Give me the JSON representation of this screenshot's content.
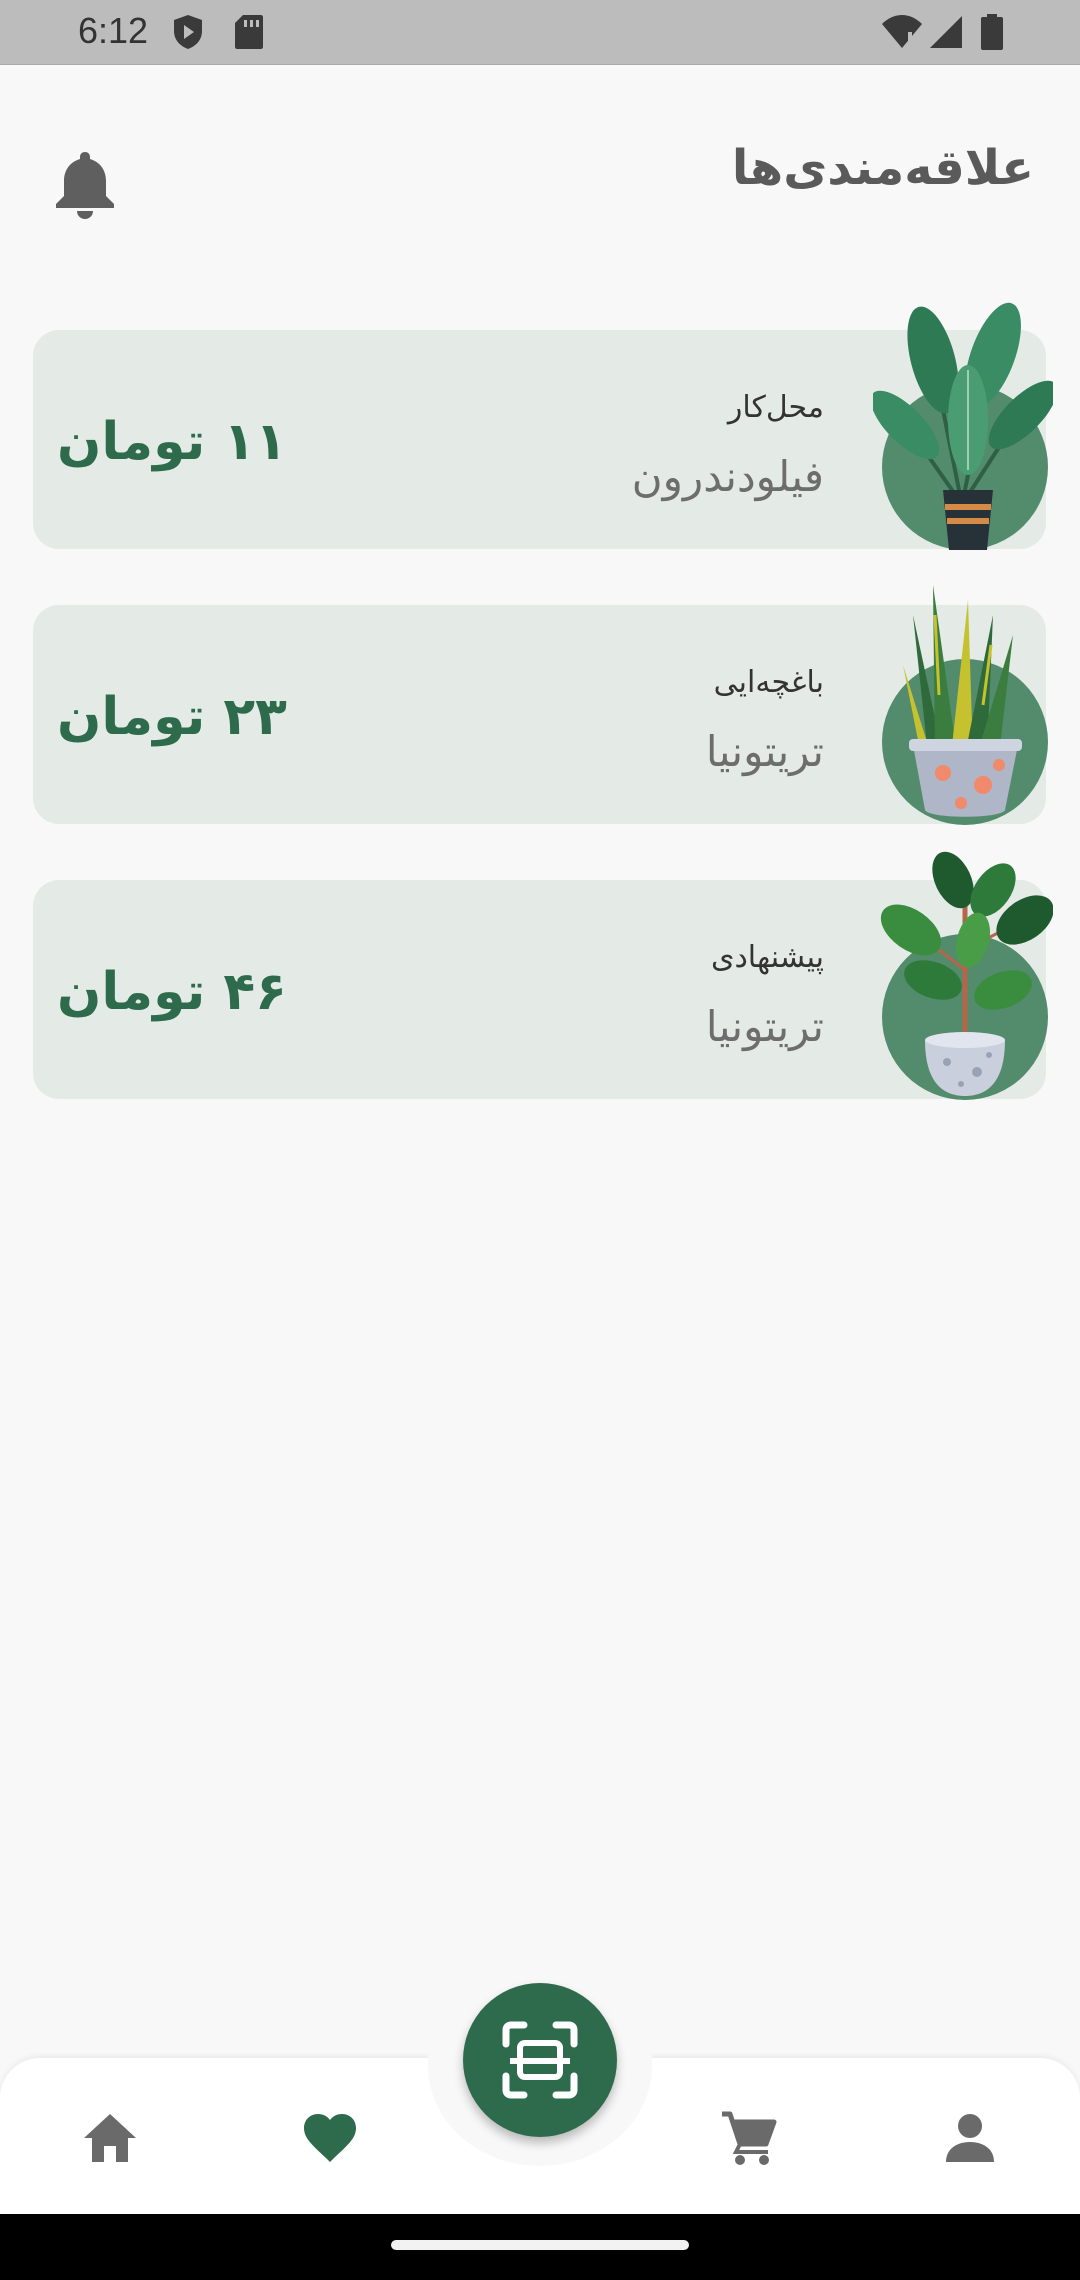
{
  "status_bar": {
    "time": "6:12",
    "icons": [
      "shield-play-icon",
      "sd-card-icon",
      "wifi-icon",
      "signal-icon",
      "battery-icon"
    ]
  },
  "header": {
    "title": "علاقه‌مندی‌ها",
    "bell_icon": "bell-icon"
  },
  "favorites": [
    {
      "category": "محل‌کار",
      "name": "فیلودندرون",
      "price": "۱۱ تومان",
      "plant": "philodendron"
    },
    {
      "category": "باغچه‌ایی",
      "name": "تریتونیا",
      "price": "۲۳ تومان",
      "plant": "snake-plant"
    },
    {
      "category": "پیشنهادی",
      "name": "تریتونیا",
      "price": "۴۶ تومان",
      "plant": "rubber-plant"
    }
  ],
  "bottom_nav": {
    "items": [
      "home-icon",
      "heart-icon",
      "scan-icon",
      "cart-icon",
      "profile-icon"
    ],
    "active": "heart-icon"
  },
  "colors": {
    "accent": "#2e6b4c",
    "card_bg": "#e4ebe6",
    "circle": "#538c6c"
  }
}
